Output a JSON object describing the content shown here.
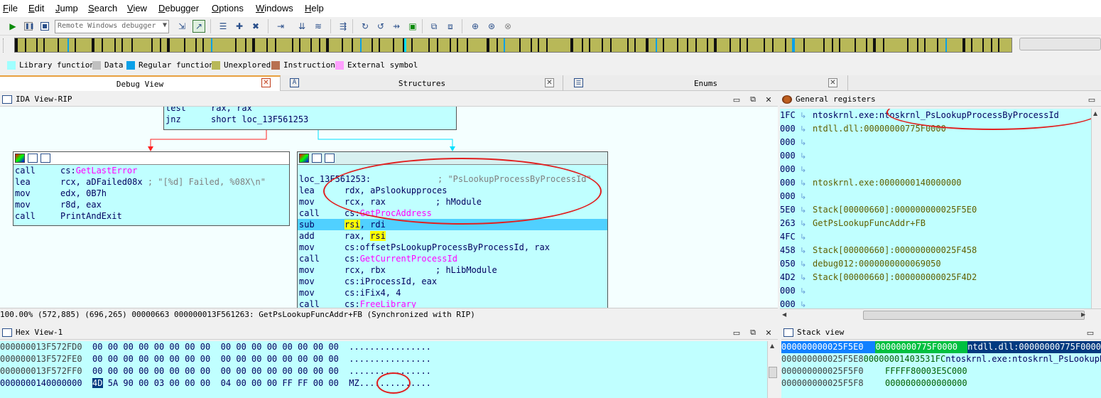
{
  "menu": [
    "File",
    "Edit",
    "Jump",
    "Search",
    "View",
    "Debugger",
    "Options",
    "Windows",
    "Help"
  ],
  "toolbar": {
    "debugger_select": "Remote Windows debugger",
    "icons": [
      "play-icon",
      "pause-icon",
      "stop-icon",
      "attach-icon",
      "detach-icon",
      "breakpoint-list-icon",
      "add-breakpoint-icon",
      "delete-breakpoint-icon",
      "step-into-icon",
      "step-over-icon",
      "run-until-return-icon",
      "run-to-cursor-icon",
      "trace-icon",
      "instruction-trace-icon",
      "function-trace-icon",
      "show-registers-icon",
      "show-stack-icon",
      "add-watch-icon",
      "delete-watch-icon"
    ]
  },
  "legend": [
    {
      "label": "Library function",
      "color": "#a0ffff"
    },
    {
      "label": "Data",
      "color": "#c0c0c0"
    },
    {
      "label": "Regular function",
      "color": "#0aa0e8"
    },
    {
      "label": "Unexplored",
      "color": "#b8b858"
    },
    {
      "label": "Instruction",
      "color": "#b87050"
    },
    {
      "label": "External symbol",
      "color": "#ffa0ff"
    }
  ],
  "tabs": {
    "debug_view": "Debug View",
    "structures": "Structures",
    "enums": "Enums"
  },
  "ida_view": {
    "title": "IDA View-RIP",
    "top_node": [
      {
        "mn": "test",
        "op": "rax, rax"
      },
      {
        "mn": "jnz",
        "op": "short loc_13F561253"
      }
    ],
    "left_node": [
      {
        "mn": "call",
        "op_pre": "cs:",
        "op_fn": "GetLastError",
        "op_post": "",
        "cm": ""
      },
      {
        "mn": "lea",
        "op_pre": "rcx, aDFailed08x",
        "op_fn": "",
        "op_post": "",
        "cm": " ; \"[%d] Failed, %08X\\n\""
      },
      {
        "mn": "mov",
        "op_pre": "edx, 0B7h",
        "op_fn": "",
        "op_post": "",
        "cm": ""
      },
      {
        "mn": "mov",
        "op_pre": "r8d, eax",
        "op_fn": "",
        "op_post": "",
        "cm": ""
      },
      {
        "mn": "call",
        "op_pre": "PrintAndExit",
        "op_fn": "",
        "op_post": "",
        "cm": ""
      }
    ],
    "right_node_label": "loc_13F561253:",
    "right_node_label_comment": "; \"PsLookupProcessByProcessId\"",
    "right_node": [
      {
        "mn": "lea",
        "op": "rdx, aPslookupproces",
        "cm": ""
      },
      {
        "mn": "mov",
        "op": "rcx, rax",
        "cm": "; hModule"
      },
      {
        "mn": "call",
        "op": "cs:",
        "fn": "GetProcAddress",
        "cm": ""
      },
      {
        "mn": "sub",
        "op": "rsi, rdi",
        "cm": ""
      },
      {
        "mn": "add",
        "op": "rax, rsi",
        "cm": ""
      },
      {
        "mn": "mov",
        "op": "cs:offsetPsLookupProcessByProcessId, rax",
        "cm": ""
      },
      {
        "mn": "call",
        "op": "cs:",
        "fn": "GetCurrentProcessId",
        "cm": ""
      },
      {
        "mn": "mov",
        "op": "rcx, rbx",
        "cm": "; hLibModule"
      },
      {
        "mn": "mov",
        "op": "cs:iProcessId, eax",
        "cm": ""
      },
      {
        "mn": "mov",
        "op": "cs:iFix4, 4",
        "cm": ""
      },
      {
        "mn": "call",
        "op": "cs:",
        "fn": "FreeLibrary",
        "cm": ""
      }
    ],
    "status": "100.00% (572,885) (696,265) 00000663 000000013F561263: GetPsLookupFuncAddr+FB (Synchronized with RIP)"
  },
  "registers": {
    "title": "General registers",
    "rows": [
      {
        "v": "1FC",
        "t": "ntoskrnl.exe:ntoskrnl_PsLookupProcessByProcessId"
      },
      {
        "v": "000",
        "t": "ntdll.dll:00000000775F0000"
      },
      {
        "v": "000",
        "t": ""
      },
      {
        "v": "000",
        "t": ""
      },
      {
        "v": "000",
        "t": ""
      },
      {
        "v": "000",
        "t": "ntoskrnl.exe:0000000140000000"
      },
      {
        "v": "000",
        "t": ""
      },
      {
        "v": "5E0",
        "t": "Stack[00000660]:000000000025F5E0"
      },
      {
        "v": "263",
        "t": "GetPsLookupFuncAddr+FB"
      },
      {
        "v": "4FC",
        "t": ""
      },
      {
        "v": "458",
        "t": "Stack[00000660]:000000000025F458"
      },
      {
        "v": "050",
        "t": "debug012:0000000000069050"
      },
      {
        "v": "4D2",
        "t": "Stack[00000660]:000000000025F4D2"
      },
      {
        "v": "000",
        "t": ""
      },
      {
        "v": "000",
        "t": ""
      }
    ]
  },
  "hex_view": {
    "title": "Hex View-1",
    "rows": [
      {
        "addr": "000000013F572FD0",
        "b1": "00 00 00 00 00 00 00 00",
        "b2": "00 00 00 00 00 00 00 00",
        "ascii": "................"
      },
      {
        "addr": "000000013F572FE0",
        "b1": "00 00 00 00 00 00 00 00",
        "b2": "00 00 00 00 00 00 00 00",
        "ascii": "................"
      },
      {
        "addr": "000000013F572FF0",
        "b1": "00 00 00 00 00 00 00 00",
        "b2": "00 00 00 00 00 00 00 00",
        "ascii": "................"
      },
      {
        "addr": "0000000140000000",
        "b1first": "4D",
        "b1": " 5A 90 00 03 00 00 00",
        "b2": "04 00 00 00 FF FF 00 00",
        "ascii": "MZ.............."
      }
    ]
  },
  "stack_view": {
    "title": "Stack view",
    "rows": [
      {
        "a": "000000000025F5E0",
        "v": "00000000775F0000",
        "t": "ntdll.dll:00000000775F0000"
      },
      {
        "a": "000000000025F5E8",
        "v": "00000001403531FC",
        "t": "ntoskrnl.exe:ntoskrnl_PsLookupProcessByProcessId"
      },
      {
        "a": "000000000025F5F0",
        "v": "FFFFF80003E5C000",
        "t": ""
      },
      {
        "a": "000000000025F5F8",
        "v": "0000000000000000",
        "t": ""
      }
    ]
  },
  "colors": {
    "graph_bg": "#f4ffff",
    "node_bg": "#c0ffff",
    "selected_line": "#50d0ff",
    "highlight": "#ffff00",
    "annotation": "#e02020"
  }
}
